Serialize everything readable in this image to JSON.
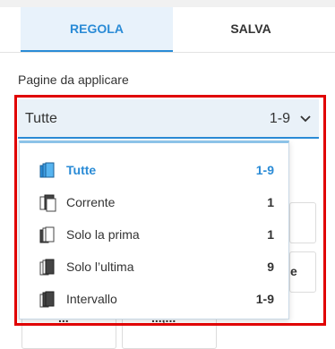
{
  "tabs": [
    {
      "label": "REGOLA",
      "active": true
    },
    {
      "label": "SALVA",
      "active": false
    }
  ],
  "section": {
    "label": "Pagine da applicare"
  },
  "select": {
    "value": "Tutte",
    "range": "1-9"
  },
  "background": {
    "partial_letter": "e",
    "partial_bottom_left": "...",
    "partial_bottom_right": "...,..."
  },
  "options": [
    {
      "label": "Tutte",
      "count": "1-9",
      "icon": "pages-all-icon",
      "selected": true
    },
    {
      "label": "Corrente",
      "count": "1",
      "icon": "page-current-icon",
      "selected": false
    },
    {
      "label": "Solo la prima",
      "count": "1",
      "icon": "page-first-icon",
      "selected": false
    },
    {
      "label": "Solo l’ultima",
      "count": "9",
      "icon": "page-last-icon",
      "selected": false
    },
    {
      "label": "Intervallo",
      "count": "1-9",
      "icon": "page-range-icon",
      "selected": false
    }
  ],
  "colors": {
    "accent": "#2a8bd6",
    "highlight": "#e00000"
  }
}
